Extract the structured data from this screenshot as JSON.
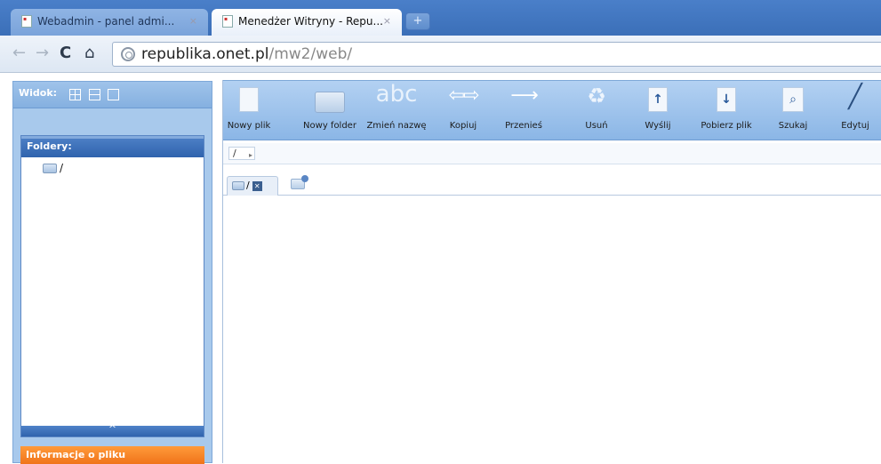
{
  "browser": {
    "tabs": [
      {
        "title": "Webadmin - panel admi...",
        "close": "×"
      },
      {
        "title": "Menedżer Witryny - Repu...",
        "close": "×"
      }
    ],
    "new_tab": "+",
    "nav": {
      "back": "←",
      "forward": "→",
      "reload": "C",
      "home": "⌂"
    },
    "url": {
      "host": "republika.onet.pl",
      "path": "/mw2/web/"
    }
  },
  "left": {
    "view_label": "Widok:",
    "folders_title": "Foldery:",
    "tree_root": "/",
    "collapse_glyph": "^",
    "info_title": "Informacje o pliku"
  },
  "ribbon": {
    "new_file": "Nowy plik",
    "new_folder": "Nowy folder",
    "rename": "Zmień nazwę",
    "rename_icon_text": "abc",
    "copy": "Kopiuj",
    "move": "Przenieś",
    "delete": "Usuń",
    "upload": "Wyślij",
    "download": "Pobierz plik",
    "search": "Szukaj",
    "edit": "Edytuj"
  },
  "path": {
    "current": "/",
    "arrow": "▸"
  },
  "folder_tabs": [
    {
      "label": "/",
      "close": "✕"
    }
  ]
}
